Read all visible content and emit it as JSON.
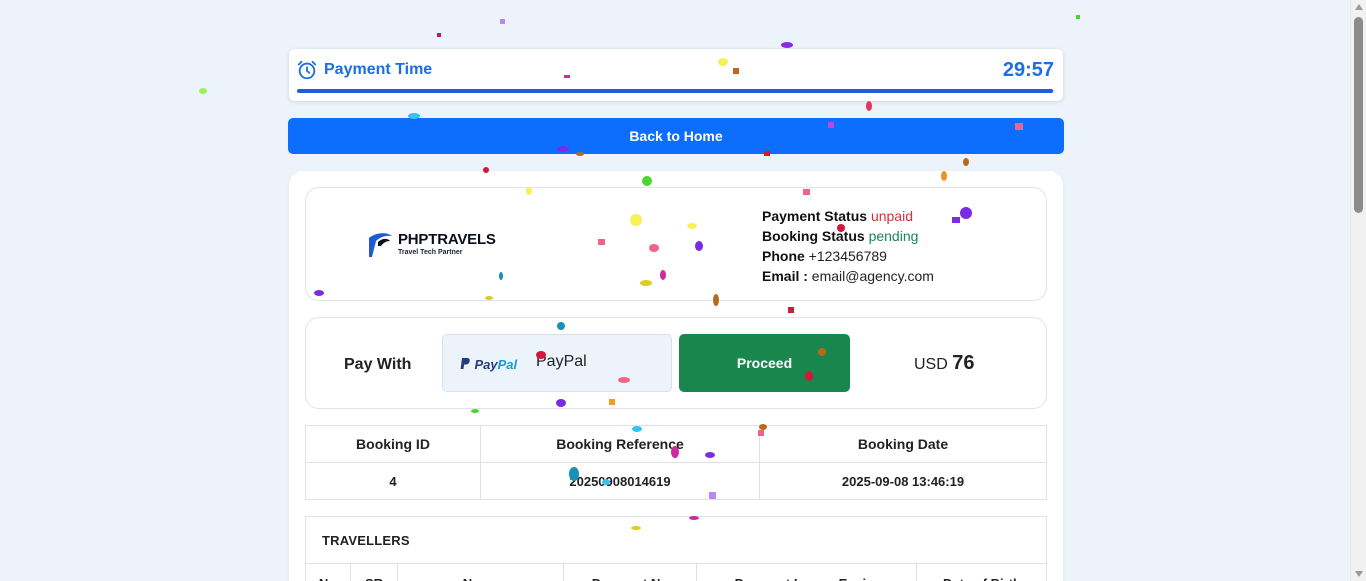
{
  "timer": {
    "title": "Payment Time",
    "time": "29:57",
    "progress": 0.998
  },
  "home_button": "Back to Home",
  "brand": {
    "name": "PHPTRAVELS",
    "tagline": "Travel Tech Partner"
  },
  "status": {
    "payment_label": "Payment Status",
    "payment_value": "unpaid",
    "booking_label": "Booking Status",
    "booking_value": "pending",
    "phone_label": "Phone",
    "phone_value": "+123456789",
    "email_label": "Email :",
    "email_value": "email@agency.com"
  },
  "payment": {
    "pay_with": "Pay With",
    "paypal_logo_a": "Pay",
    "paypal_logo_b": "Pal",
    "method": "PayPal",
    "proceed": "Proceed",
    "currency": "USD",
    "amount": "76"
  },
  "booking_table": {
    "headers": [
      "Booking ID",
      "Booking Reference",
      "Booking Date"
    ],
    "row": [
      "4",
      "20250908014619",
      "2025-09-08 13:46:19"
    ]
  },
  "travellers": {
    "title": "TRAVELLERS",
    "headers": [
      "No",
      "SR",
      "Name",
      "Passport No",
      "Passport Issue - Expiry",
      "Date of Birth"
    ]
  },
  "colors": {
    "accent": "#0d6efd",
    "proceed": "#19864e",
    "unpaid": "#d03535",
    "pending": "#19875a"
  }
}
